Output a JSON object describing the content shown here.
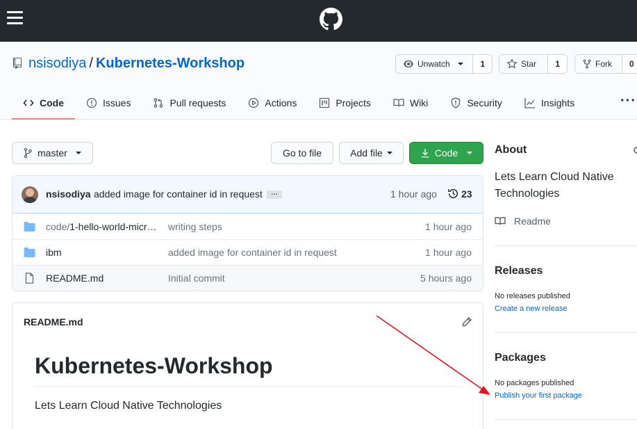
{
  "topbar": {
    "menu_icon": "hamburger-menu-icon",
    "logo_icon": "github-logo-icon",
    "bg": "#24292e"
  },
  "repo": {
    "owner": "nsisodiya",
    "separator": "/",
    "name": "Kubernetes-Workshop",
    "watch": {
      "label": "Unwatch",
      "count": "1"
    },
    "star": {
      "label": "Star",
      "count": "1"
    },
    "fork": {
      "label": "Fork",
      "count": "0"
    }
  },
  "tabs": [
    {
      "label": "Code",
      "icon": "code-icon"
    },
    {
      "label": "Issues",
      "icon": "issue-icon"
    },
    {
      "label": "Pull requests",
      "icon": "pull-request-icon"
    },
    {
      "label": "Actions",
      "icon": "play-icon"
    },
    {
      "label": "Projects",
      "icon": "project-icon"
    },
    {
      "label": "Wiki",
      "icon": "book-icon"
    },
    {
      "label": "Security",
      "icon": "shield-icon"
    },
    {
      "label": "Insights",
      "icon": "graph-icon"
    }
  ],
  "more_label": "···",
  "toolbar": {
    "branch": "master",
    "go_to_file": "Go to file",
    "add_file": "Add file",
    "code": "Code",
    "accent": "#2ea44f"
  },
  "commit": {
    "author": "nsisodiya",
    "message": "added image for container id in request",
    "ellipsis": "…",
    "time": "1 hour ago",
    "count": "23"
  },
  "files": [
    {
      "type": "dir",
      "prefix": "code/",
      "name": "1-hello-world-micr…",
      "message": "writing steps",
      "time": "1 hour ago"
    },
    {
      "type": "dir",
      "prefix": "",
      "name": "ibm",
      "message": "added image for container id in request",
      "time": "1 hour ago"
    },
    {
      "type": "file",
      "prefix": "",
      "name": "README.md",
      "message": "Initial commit",
      "time": "5 hours ago"
    }
  ],
  "readme": {
    "filename": "README.md",
    "heading": "Kubernetes-Workshop",
    "paragraph": "Lets Learn Cloud Native Technologies"
  },
  "sidebar": {
    "about_title": "About",
    "about_desc": "Lets Learn Cloud Native Technologies",
    "readme_label": "Readme",
    "releases_title": "Releases",
    "releases_none": "No releases published",
    "releases_link": "Create a new release",
    "packages_title": "Packages",
    "packages_none": "No packages published",
    "packages_link": "Publish your first package"
  },
  "annotation_color": "#e8141a"
}
